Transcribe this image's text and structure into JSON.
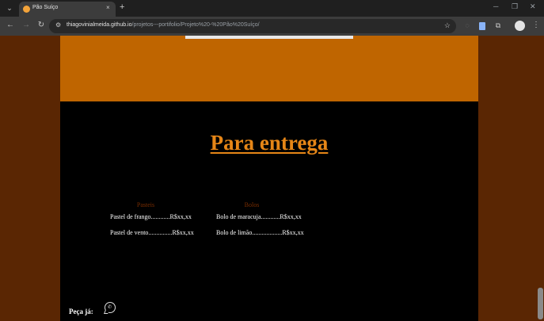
{
  "browser": {
    "tab_title": "Pão Suíço",
    "tab_close": "×",
    "new_tab": "+",
    "url_host": "thiagovinialmeida.github.io",
    "url_path": "/projetos---portifolio/Projeto%20-%20Pão%20Suíço/",
    "icons": [
      "tab-search-icon",
      "pao-suico-favicon",
      "close-icon",
      "new-tab-icon",
      "back-icon",
      "forward-icon",
      "reload-icon",
      "site-info-icon",
      "bookmark-star-icon",
      "extension-icon",
      "puzzle-icon",
      "profile-icon",
      "more-menu-icon",
      "minimize-icon",
      "maximize-icon",
      "close-window-icon"
    ]
  },
  "page": {
    "colors": {
      "side_bg": "#5a2603",
      "hero_bg": "#bf6500",
      "content_bg": "#000000",
      "title": "#e68617",
      "heading": "#7a2d00"
    },
    "section_title": "Para entrega",
    "menu": {
      "columns": [
        {
          "heading": "Pasteis",
          "items": [
            {
              "name": "Pastel de frango",
              "dots": "............",
              "price": "R$xx,xx"
            },
            {
              "name": "Pastel de vento",
              "dots": "...............",
              "price": "R$xx,xx"
            }
          ]
        },
        {
          "heading": "Bolos",
          "items": [
            {
              "name": "Bolo de maracuja",
              "dots": "............",
              "price": "R$xx,xx"
            },
            {
              "name": "Bolo de limão",
              "dots": "...................",
              "price": "R$xx,xx"
            }
          ]
        }
      ]
    },
    "order_label": "Peça já:",
    "order_icon": "whatsapp-icon"
  }
}
